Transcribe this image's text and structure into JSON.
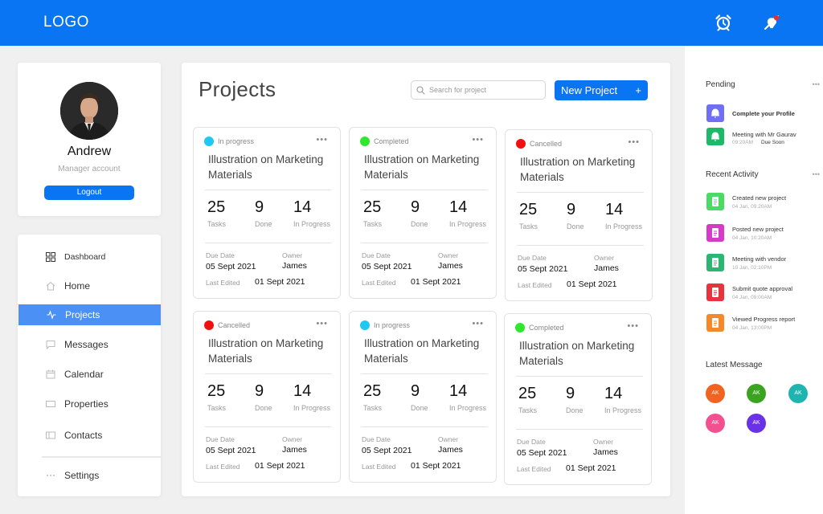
{
  "header": {
    "logo": "LOGO",
    "icons": [
      "alarm-clock-icon",
      "notification-off-icon"
    ],
    "brand_color": "#0a75f2"
  },
  "profile": {
    "name": "Andrew",
    "role": "Manager account",
    "logout_label": "Logout"
  },
  "sidebar": {
    "items": [
      {
        "label": "Dashboard",
        "icon": "grid-icon",
        "active": false
      },
      {
        "label": "Home",
        "icon": "home-icon",
        "active": false
      },
      {
        "label": "Projects",
        "icon": "activity-icon",
        "active": true
      },
      {
        "label": "Messages",
        "icon": "message-icon",
        "active": false
      },
      {
        "label": "Calendar",
        "icon": "calendar-icon",
        "active": false
      },
      {
        "label": "Properties",
        "icon": "folder-icon",
        "active": false
      },
      {
        "label": "Contacts",
        "icon": "contacts-icon",
        "active": false
      },
      {
        "label": "Settings",
        "icon": "dots-icon",
        "active": false
      }
    ]
  },
  "main": {
    "title": "Projects",
    "search_placeholder": "Search for project",
    "new_project_label": "New Project",
    "new_project_plus": "+",
    "stat_labels": {
      "tasks": "Tasks",
      "done": "Done",
      "in_progress": "In Progress"
    },
    "meta_labels": {
      "due_date": "Due Date",
      "owner": "Owner",
      "last_edited": "Last Edited"
    },
    "projects": [
      {
        "status": "In progress",
        "status_color": "#1ec8f0",
        "title": "Illustration on Marketing Materials",
        "tasks": "25",
        "done": "9",
        "in_progress": "14",
        "due_date": "05 Sept 2021",
        "owner": "James",
        "last_edited": "01 Sept 2021"
      },
      {
        "status": "Completed",
        "status_color": "#2ee82e",
        "title": "Illustration on Marketing Materials",
        "tasks": "25",
        "done": "9",
        "in_progress": "14",
        "due_date": "05 Sept 2021",
        "owner": "James",
        "last_edited": "01 Sept 2021"
      },
      {
        "status": "Cancelled",
        "status_color": "#f01010",
        "title": "Illustration on Marketing Materials",
        "tasks": "25",
        "done": "9",
        "in_progress": "14",
        "due_date": "05 Sept 2021",
        "owner": "James",
        "last_edited": "01 Sept 2021"
      },
      {
        "status": "Cancelled",
        "status_color": "#f01010",
        "title": "Illustration on Marketing Materials",
        "tasks": "25",
        "done": "9",
        "in_progress": "14",
        "due_date": "05 Sept 2021",
        "owner": "James",
        "last_edited": "01 Sept 2021"
      },
      {
        "status": "In progress",
        "status_color": "#1ec8f0",
        "title": "Illustration on Marketing Materials",
        "tasks": "25",
        "done": "9",
        "in_progress": "14",
        "due_date": "05 Sept 2021",
        "owner": "James",
        "last_edited": "01 Sept 2021"
      },
      {
        "status": "Completed",
        "status_color": "#2ee82e",
        "title": "Illustration on Marketing Materials",
        "tasks": "25",
        "done": "9",
        "in_progress": "14",
        "due_date": "05 Sept 2021",
        "owner": "James",
        "last_edited": "01 Sept 2021"
      }
    ]
  },
  "right": {
    "pending_heading": "Pending",
    "pending": [
      {
        "text": "Complete your Profile",
        "sub": "",
        "sub2": "",
        "color": "#6f6ef5",
        "icon": "bell-icon"
      },
      {
        "text": "Meeting with Mr Gaurav",
        "sub": "09:20AM",
        "sub2": "Due Soon",
        "color": "#1db86a",
        "icon": "bell-icon"
      }
    ],
    "activity_heading": "Recent Activity",
    "activity": [
      {
        "text": "Created new project",
        "sub": "04 Jan, 09:20AM",
        "color": "#4cd964",
        "icon": "clipboard-icon"
      },
      {
        "text": "Posted new project",
        "sub": "04 Jan, 10:20AM",
        "color": "#d63ac9",
        "icon": "post-icon"
      },
      {
        "text": "Meeting with vendor",
        "sub": "10 Jan, 02:10PM",
        "color": "#2bb673",
        "icon": "microphone-icon"
      },
      {
        "text": "Submit quote approval",
        "sub": "04 Jan, 09:00AM",
        "color": "#e8333f",
        "icon": "clipboard-icon"
      },
      {
        "text": "Viewed Progress report",
        "sub": "04 Jan, 13:00PM",
        "color": "#f5892a",
        "icon": "clipboard-icon"
      }
    ],
    "messages_heading": "Latest Message",
    "messages": [
      {
        "initials": "AK",
        "color": "#f26322"
      },
      {
        "initials": "AK",
        "color": "#3aa31f"
      },
      {
        "initials": "AK",
        "color": "#1eb5b0"
      },
      {
        "initials": "AK",
        "color": "#f2508e"
      },
      {
        "initials": "AK",
        "color": "#6a32e6"
      }
    ]
  }
}
